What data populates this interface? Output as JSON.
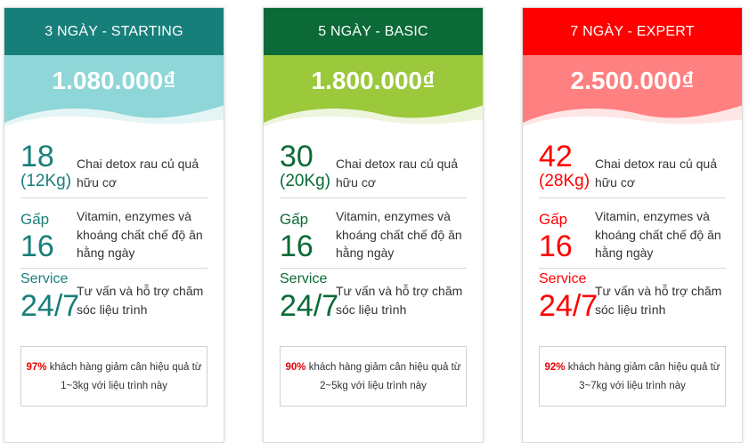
{
  "plans": [
    {
      "title": "3 NGÀY - STARTING",
      "price": "1.080.000₫",
      "bottles": "18",
      "bottles_weight": "(12Kg)",
      "bottles_desc": "Chai detox rau củ quả hữu cơ",
      "multiplier_label": "Gấp",
      "multiplier": "16",
      "multiplier_desc": "Vitamin, enzymes và khoáng chất chế độ ăn hằng ngày",
      "service_label": "Service",
      "service": "24/7",
      "service_desc": "Tư vấn và hỗ trợ chăm sóc liệu trình",
      "note_percent": "97%",
      "note_text": " khách hàng giảm cân hiệu quả từ 1~3kg với liệu trình này",
      "colors": {
        "header": "#177f7a",
        "price_bg": "#8fd6d8",
        "accent": "#177f7a",
        "wave_back": "#e5f5f5"
      }
    },
    {
      "title": "5 NGÀY - BASIC",
      "price": "1.800.000₫",
      "bottles": "30",
      "bottles_weight": "(20Kg)",
      "bottles_desc": "Chai detox rau củ quả hữu cơ",
      "multiplier_label": "Gấp",
      "multiplier": "16",
      "multiplier_desc": "Vitamin, enzymes và khoáng chất chế độ ăn hằng ngày",
      "service_label": "Service",
      "service": "24/7",
      "service_desc": "Tư vấn và hỗ trợ chăm sóc liệu trình",
      "note_percent": "90%",
      "note_text": " khách hàng giảm cân hiệu quả từ 2~5kg với liệu trình này",
      "colors": {
        "header": "#0b6a37",
        "price_bg": "#9bc93b",
        "accent": "#0b6a37",
        "wave_back": "#eef5dd"
      }
    },
    {
      "title": "7 NGÀY - EXPERT",
      "price": "2.500.000₫",
      "bottles": "42",
      "bottles_weight": "(28Kg)",
      "bottles_desc": "Chai detox rau củ quả hữu cơ",
      "multiplier_label": "Gấp",
      "multiplier": "16",
      "multiplier_desc": "Vitamin, enzymes và khoáng chất chế độ ăn hằng ngày",
      "service_label": "Service",
      "service": "24/7",
      "service_desc": "Tư vấn và hỗ trợ chăm sóc liệu trình",
      "note_percent": "92%",
      "note_text": " khách hàng giảm cân hiệu quả từ 3~7kg với liệu trình này",
      "colors": {
        "header": "#ff0000",
        "price_bg": "#ff8080",
        "accent": "#ff0000",
        "wave_back": "#ffe6e6"
      }
    }
  ]
}
